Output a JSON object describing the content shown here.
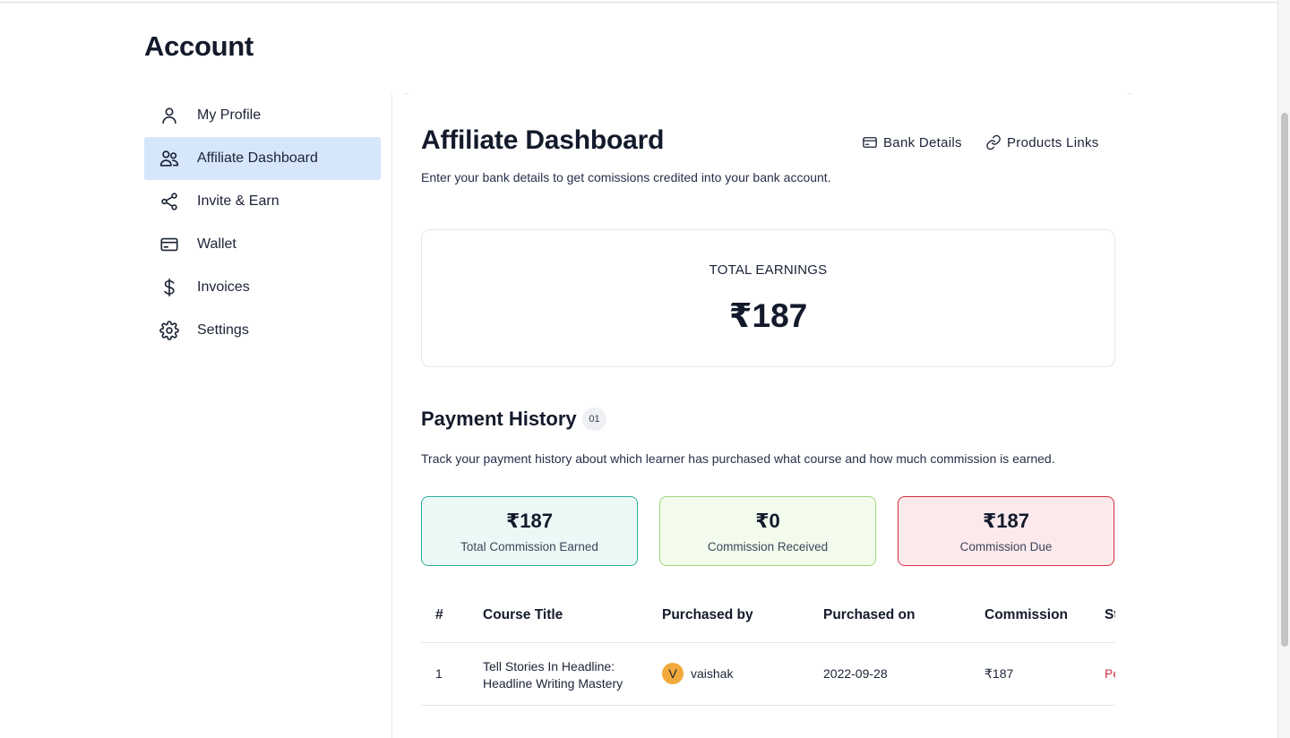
{
  "page": {
    "title": "Account"
  },
  "sidebar": {
    "items": [
      {
        "label": "My Profile",
        "icon": "user-icon",
        "active": false
      },
      {
        "label": "Affiliate Dashboard",
        "icon": "users-icon",
        "active": true
      },
      {
        "label": "Invite & Earn",
        "icon": "share-icon",
        "active": false
      },
      {
        "label": "Wallet",
        "icon": "credit-card-icon",
        "active": false
      },
      {
        "label": "Invoices",
        "icon": "dollar-icon",
        "active": false
      },
      {
        "label": "Settings",
        "icon": "gear-icon",
        "active": false
      }
    ]
  },
  "dashboard": {
    "title": "Affiliate Dashboard",
    "subtitle": "Enter your bank details to get comissions credited into your bank account.",
    "bank_details_label": "Bank Details",
    "products_links_label": "Products Links",
    "total_earnings_label": "TOTAL EARNINGS",
    "total_earnings_value": "₹187"
  },
  "payment_history": {
    "title": "Payment History",
    "count": "01",
    "subtitle": "Track your payment history about which learner has purchased what course and how much commission is earned.",
    "stats": {
      "earned": {
        "value": "₹187",
        "label": "Total Commission Earned"
      },
      "received": {
        "value": "₹0",
        "label": "Commission Received"
      },
      "due": {
        "value": "₹187",
        "label": "Commission Due"
      }
    },
    "columns": [
      "#",
      "Course Title",
      "Purchased by",
      "Purchased on",
      "Commission",
      "St"
    ],
    "rows": [
      {
        "index": "1",
        "course": "Tell Stories In Headline: Headline Writing Mastery",
        "avatar_initial": "V",
        "purchased_by": "vaishak",
        "purchased_on": "2022-09-28",
        "commission": "₹187",
        "status": "Pe"
      }
    ]
  },
  "colors": {
    "active_bg": "#d6e6fb",
    "earned_border": "#2fae9e",
    "received_border": "#9ed67b",
    "due_border": "#d3303f",
    "avatar_bg": "#f2a93b",
    "status_text": "#d3303f"
  }
}
